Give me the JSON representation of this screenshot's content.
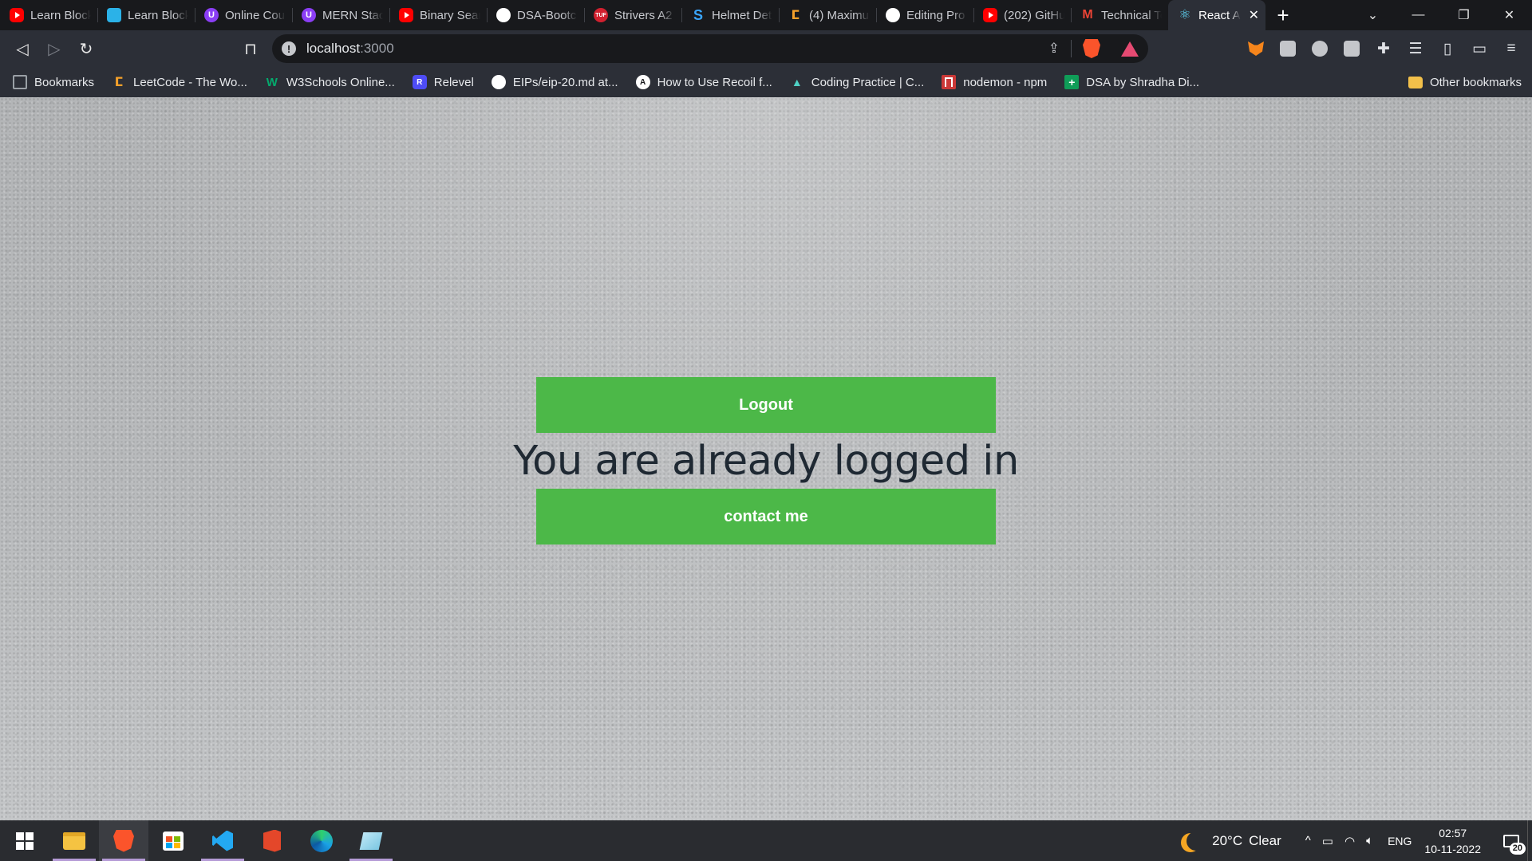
{
  "browser": {
    "tabs": [
      {
        "label": "Learn Block",
        "favicon": "youtube-icon"
      },
      {
        "label": "Learn Block",
        "favicon": "cube-icon"
      },
      {
        "label": "Online Cou",
        "favicon": "purple-u-icon"
      },
      {
        "label": "MERN Stac",
        "favicon": "purple-u-icon"
      },
      {
        "label": "Binary Sear",
        "favicon": "youtube-icon"
      },
      {
        "label": "DSA-Bootc",
        "favicon": "github-icon"
      },
      {
        "label": "Strivers A2",
        "favicon": "tuf-icon"
      },
      {
        "label": "Helmet Det",
        "favicon": "s-icon"
      },
      {
        "label": "(4) Maximu",
        "favicon": "leetcode-icon"
      },
      {
        "label": "Editing Pro",
        "favicon": "github-icon"
      },
      {
        "label": "(202) GitHu",
        "favicon": "youtube-icon"
      },
      {
        "label": "Technical Te",
        "favicon": "gmail-icon"
      },
      {
        "label": "React A",
        "favicon": "react-icon",
        "active": true
      }
    ],
    "new_tab_symbol": "+",
    "tab_close_symbol": "✕",
    "window_controls": {
      "minimize": "—",
      "restore": "❐",
      "close": "✕",
      "dropdown": "⌄"
    },
    "address": {
      "host": "localhost",
      "port": ":3000"
    },
    "bookmarks": [
      {
        "label": "Bookmarks",
        "favicon": "bookmarks-icon"
      },
      {
        "label": "LeetCode - The Wo...",
        "favicon": "leetcode-icon"
      },
      {
        "label": "W3Schools Online...",
        "favicon": "w3schools-icon"
      },
      {
        "label": "Relevel",
        "favicon": "relevel-icon"
      },
      {
        "label": "EIPs/eip-20.md at...",
        "favicon": "github-icon"
      },
      {
        "label": "How to Use Recoil f...",
        "favicon": "a-icon"
      },
      {
        "label": "Coding Practice | C...",
        "favicon": "coding-practice-icon"
      },
      {
        "label": "nodemon - npm",
        "favicon": "npm-icon"
      },
      {
        "label": "DSA by Shradha Di...",
        "favicon": "sheets-icon"
      }
    ],
    "other_bookmarks": "Other bookmarks"
  },
  "page": {
    "logout_label": "Logout",
    "message": "You are already logged in",
    "contact_label": "contact me",
    "accent_color": "#4cb848"
  },
  "taskbar": {
    "apps": [
      "start",
      "file-explorer",
      "brave",
      "microsoft-store",
      "vscode",
      "office",
      "edge",
      "notes"
    ],
    "weather": {
      "temperature": "20°C",
      "condition": "Clear"
    },
    "language": "ENG",
    "time": "02:57",
    "date": "10-11-2022",
    "notification_count": "20"
  }
}
